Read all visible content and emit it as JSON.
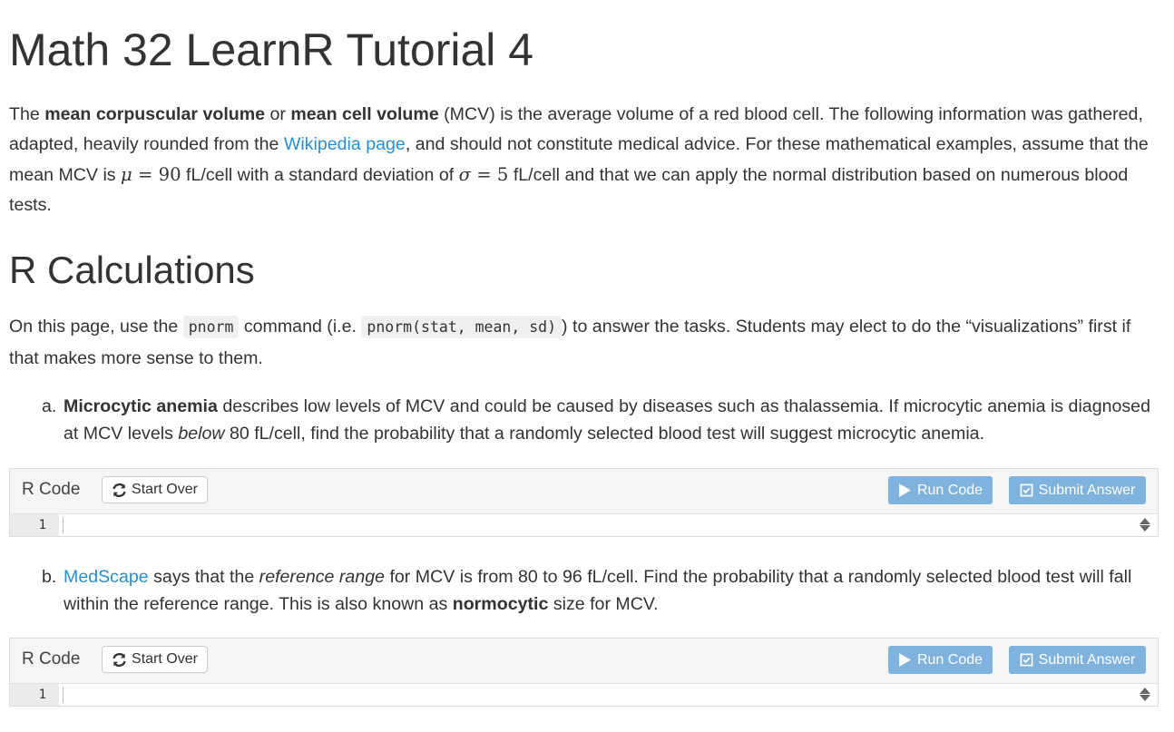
{
  "title": "Math 32 LearnR Tutorial 4",
  "intro": {
    "t1": "The ",
    "b1": "mean corpuscular volume",
    "t2": " or ",
    "b2": "mean cell volume",
    "t3": " (MCV) is the average volume of a red blood cell. The following information was gathered, adapted, heavily rounded from the ",
    "link": "Wikipedia page",
    "t4": ", and should not constitute medical advice. For these mathematical examples, assume that the mean MCV is ",
    "mu_sym": "μ",
    "mu_eq": " = ",
    "mu_val": "90",
    "t5": " fL/cell with a standard deviation of ",
    "sigma_sym": "σ",
    "sigma_eq": " = ",
    "sigma_val": "5",
    "t6": " fL/cell and that we can apply the normal distribution based on numerous blood tests."
  },
  "section_heading": "R Calculations",
  "lead": {
    "t1": "On this page, use the ",
    "code1": "pnorm",
    "t2": " command (i.e. ",
    "code2": "pnorm(stat, mean, sd)",
    "t3": ") to answer the tasks. Students may elect to do the “visualizations” first if that makes more sense to them."
  },
  "items": [
    {
      "marker": "a.",
      "b1": "Microcytic anemia",
      "t1": " describes low levels of MCV and could be caused by diseases such as thalassemia. If microcytic anemia is diagnosed at MCV levels ",
      "i1": "below",
      "t2": " 80 fL/cell, find the probability that a randomly selected blood test will suggest microcytic anemia."
    },
    {
      "marker": "b.",
      "link": "MedScape",
      "t1": " says that the ",
      "i1": "reference range",
      "t2": " for MCV is from 80 to 96 fL/cell. Find the probability that a randomly selected blood test will fall within the reference range. This is also known as ",
      "b1": "normocytic",
      "t3": " size for MCV."
    }
  ],
  "exercise": {
    "label": "R Code",
    "start_over": "Start Over",
    "run_code": "Run Code",
    "submit": "Submit Answer",
    "line_number": "1"
  },
  "colors": {
    "link": "#2a8ed0",
    "button_primary": "#7fb2dc",
    "text": "#333333"
  }
}
